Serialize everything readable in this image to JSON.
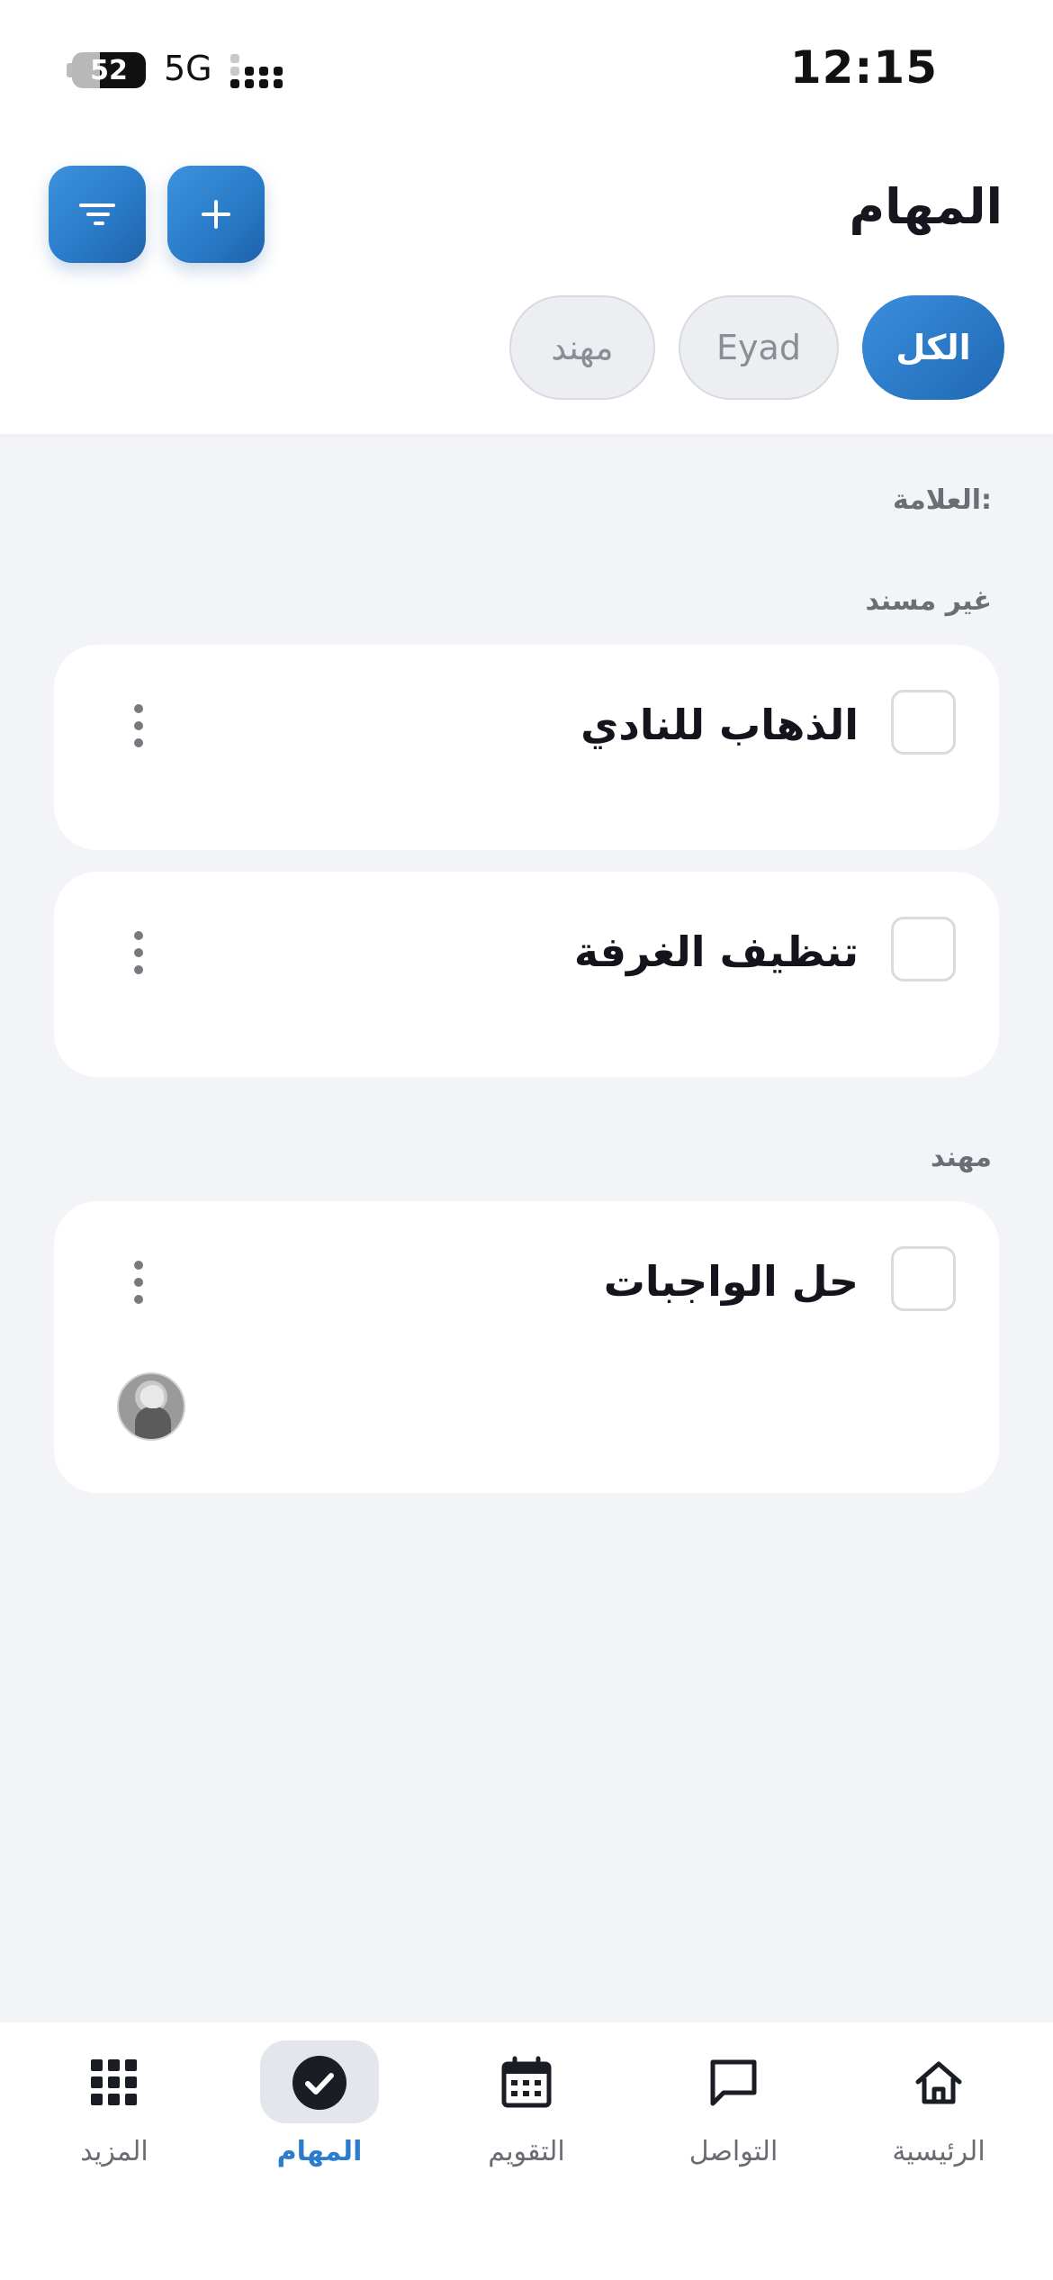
{
  "status_bar": {
    "time": "12:15",
    "battery": "52",
    "network": "5G"
  },
  "header": {
    "title": "المهام",
    "add_icon": "plus-icon",
    "filter_icon": "filter-lines-icon"
  },
  "filters": {
    "chips": [
      {
        "label": "الكل",
        "active": true
      },
      {
        "label": "Eyad",
        "active": false
      },
      {
        "label": "مهند",
        "active": false
      }
    ]
  },
  "labels": {
    "tag": "العلامة:",
    "unassigned": "غير مسند",
    "person": "مهند"
  },
  "tasks": [
    {
      "title": "الذهاب للنادي",
      "checked": false
    },
    {
      "title": "تنظيف الغرفة",
      "checked": false
    },
    {
      "title": "حل الواجبات",
      "checked": false,
      "assignee_avatar": true
    }
  ],
  "bottom_nav": {
    "items": [
      {
        "label": "الرئيسية",
        "icon": "home-icon"
      },
      {
        "label": "التواصل",
        "icon": "chat-icon"
      },
      {
        "label": "التقويم",
        "icon": "calendar-icon"
      },
      {
        "label": "المهام",
        "icon": "check-circle-icon",
        "active": true
      },
      {
        "label": "المزيد",
        "icon": "grid-icon"
      }
    ]
  },
  "colors": {
    "accent": "#2b7ccc",
    "background": "#f3f4f8"
  }
}
